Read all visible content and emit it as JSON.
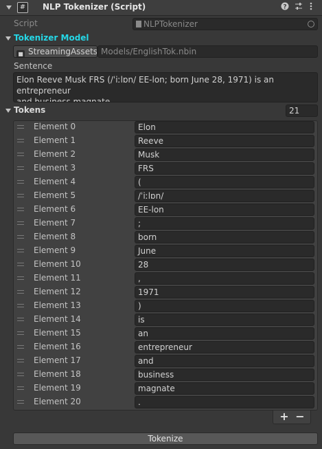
{
  "header": {
    "title": "NLP Tokenizer (Script)",
    "icon_glyph": "#"
  },
  "script_field": {
    "label": "Script",
    "value": "NLPTokenizer"
  },
  "tokenizer_model": {
    "label": "Tokenizer Model",
    "folder_button_label": "StreamingAssets/",
    "path_value": "Models/EnglishTok.nbin"
  },
  "sentence": {
    "label": "Sentence",
    "value_line1": "Elon Reeve Musk FRS (/ˈiːlɒn/ EE-lon; born June 28, 1971) is an entrepreneur",
    "value_line2": "and business magnate."
  },
  "tokens": {
    "label": "Tokens",
    "count": "21",
    "items": [
      {
        "label": "Element 0",
        "value": "Elon"
      },
      {
        "label": "Element 1",
        "value": "Reeve"
      },
      {
        "label": "Element 2",
        "value": "Musk"
      },
      {
        "label": "Element 3",
        "value": "FRS"
      },
      {
        "label": "Element 4",
        "value": "("
      },
      {
        "label": "Element 5",
        "value": "/ˈiːlɒn/"
      },
      {
        "label": "Element 6",
        "value": "EE-lon"
      },
      {
        "label": "Element 7",
        "value": ";"
      },
      {
        "label": "Element 8",
        "value": "born"
      },
      {
        "label": "Element 9",
        "value": "June"
      },
      {
        "label": "Element 10",
        "value": "28"
      },
      {
        "label": "Element 11",
        "value": ","
      },
      {
        "label": "Element 12",
        "value": "1971"
      },
      {
        "label": "Element 13",
        "value": ")"
      },
      {
        "label": "Element 14",
        "value": "is"
      },
      {
        "label": "Element 15",
        "value": "an"
      },
      {
        "label": "Element 16",
        "value": "entrepreneur"
      },
      {
        "label": "Element 17",
        "value": "and"
      },
      {
        "label": "Element 18",
        "value": "business"
      },
      {
        "label": "Element 19",
        "value": "magnate"
      },
      {
        "label": "Element 20",
        "value": "."
      }
    ],
    "add_label": "+",
    "remove_label": "−"
  },
  "tokenize_button": {
    "label": "Tokenize"
  },
  "colors": {
    "background": "#383838",
    "field_bg": "#2a2a2a",
    "accent_cyan": "#25d7e6"
  },
  "icons": [
    "foldout-arrow-icon",
    "script-hash-icon",
    "help-icon",
    "settings-sliders-icon",
    "more-menu-icon",
    "script-asset-icon",
    "object-picker-icon",
    "folder-icon",
    "drag-handle-icon"
  ]
}
